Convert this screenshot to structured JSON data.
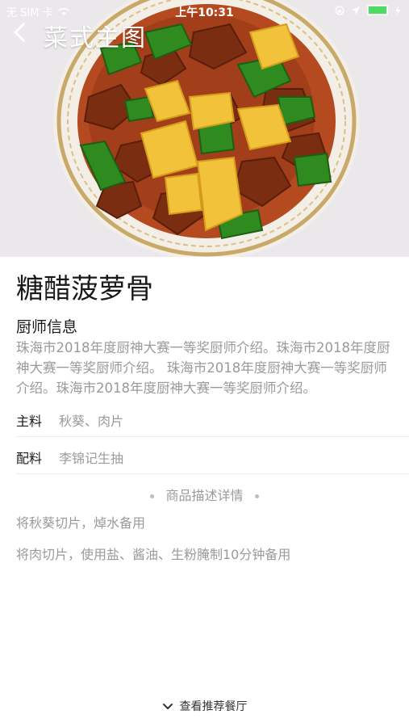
{
  "status_bar": {
    "carrier": "无 SIM 卡",
    "time": "上午10:31"
  },
  "nav": {
    "title": "菜式主图",
    "back_icon": "chevron-left-icon"
  },
  "dish": {
    "name": "糖醋菠萝骨"
  },
  "chef": {
    "heading": "厨师信息",
    "description": "珠海市2018年度厨神大赛一等奖厨师介绍。珠海市2018年度厨神大赛一等奖厨师介绍。 珠海市2018年度厨神大赛一等奖厨师介绍。珠海市2018年度厨神大赛一等奖厨师介绍。"
  },
  "ingredients": {
    "main_label": "主料",
    "main_value": "秋葵、肉片",
    "side_label": "配料",
    "side_value": "李锦记生抽"
  },
  "details": {
    "heading": "商品描述详情",
    "steps": [
      "将秋葵切片，焯水备用",
      "将肉切片，使用盐、酱油、生粉腌制10分钟备用"
    ]
  },
  "footer": {
    "more_label": "查看推荐餐厅",
    "more_icon": "chevron-down-icon"
  },
  "colors": {
    "text_primary": "#1a1a1a",
    "text_secondary": "#9a9a9a",
    "battery": "#4cd964"
  }
}
